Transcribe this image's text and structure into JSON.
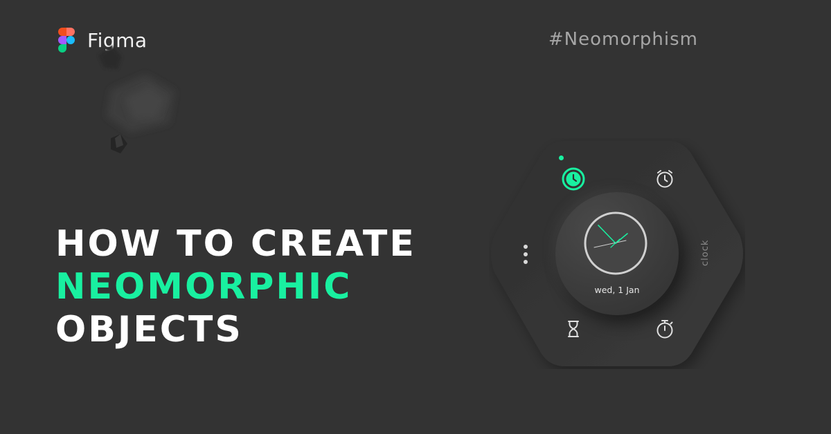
{
  "brand": {
    "name": "Figma",
    "logo_icon": "figma-logo-icon"
  },
  "hashtag": "#Neomorphism",
  "headline": {
    "line1": "HOW TO CREATE",
    "line2": "NEOMORPHIC",
    "line3": "OBJECTS"
  },
  "widget": {
    "date": "wed, 1 Jan",
    "side_label": "clock",
    "icons": [
      "clock-icon",
      "alarm-icon",
      "hourglass-icon",
      "stopwatch-icon",
      "more-vertical-icon"
    ],
    "active_mode": "clock"
  },
  "colors": {
    "background": "#333333",
    "accent": "#19f0a0",
    "text_primary": "#ffffff",
    "text_muted": "#a6a6a6"
  }
}
